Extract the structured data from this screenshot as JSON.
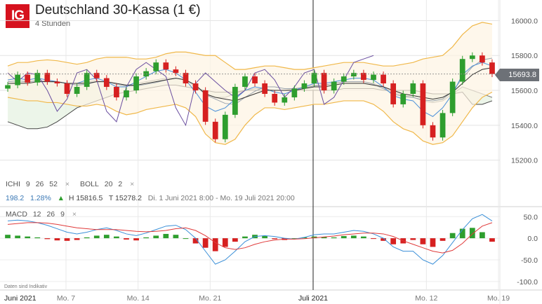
{
  "header": {
    "logo": "IG",
    "title": "Deutschland 30-Kassa (1 €)",
    "interval": "4 Stunden"
  },
  "indicators": {
    "ichi_name": "ICHI",
    "ichi_p1": "9",
    "ichi_p2": "26",
    "ichi_p3": "52",
    "boll_name": "BOLL",
    "boll_p1": "20",
    "boll_p2": "2",
    "remove_icon": "×"
  },
  "stats": {
    "value": "198.2",
    "change_pct": "1.28%",
    "high": "H 15816.5",
    "low": "T 15278.2",
    "range": "Di. 1 Juni 2021 8:00 - Mo. 19 Juli 2021 20:00"
  },
  "macd": {
    "name": "MACD",
    "p1": "12",
    "p2": "26",
    "p3": "9"
  },
  "last_price": "15693.8",
  "disclaimer": "Daten sind Indikativ",
  "colors": {
    "up": "#2e9e2e",
    "down": "#d62020",
    "band": "#f0b84a",
    "macd": "#3a8fd8",
    "signal": "#e03a3a"
  },
  "chart_data": [
    {
      "type": "line",
      "title": "Deutschland 30-Kassa (1 €)",
      "y_ticks": [
        "16000.0",
        "15800.0",
        "15600.0",
        "15400.0",
        "15200.0"
      ],
      "ylim": [
        15090,
        16070
      ],
      "last_price": 15693.8,
      "high": 15816.5,
      "low": 15278.2,
      "x_labels": [
        "Juni 2021",
        "Mo. 7",
        "Mo. 14",
        "Mo. 21",
        "Juli 2021",
        "Mo. 12",
        "Mo. 19"
      ],
      "x_days": [
        0,
        6,
        13,
        20,
        30,
        41,
        48
      ],
      "close": [
        15630,
        15690,
        15645,
        15700,
        15650,
        15640,
        15580,
        15620,
        15700,
        15670,
        15620,
        15560,
        15600,
        15680,
        15710,
        15760,
        15720,
        15700,
        15640,
        15600,
        15420,
        15320,
        15460,
        15620,
        15680,
        15640,
        15580,
        15530,
        15560,
        15610,
        15640,
        15700,
        15600,
        15650,
        15680,
        15700,
        15660,
        15690,
        15640,
        15520,
        15580,
        15640,
        15400,
        15330,
        15470,
        15650,
        15780,
        15800,
        15760,
        15694
      ],
      "bb_upper": [
        15740,
        15760,
        15760,
        15770,
        15775,
        15770,
        15760,
        15750,
        15760,
        15780,
        15790,
        15790,
        15790,
        15780,
        15780,
        15790,
        15810,
        15820,
        15820,
        15810,
        15800,
        15800,
        15760,
        15720,
        15720,
        15730,
        15740,
        15740,
        15730,
        15720,
        15720,
        15730,
        15740,
        15750,
        15760,
        15760,
        15760,
        15750,
        15740,
        15740,
        15750,
        15760,
        15780,
        15790,
        15800,
        15850,
        15920,
        15970,
        15990,
        15980
      ],
      "bb_lower": [
        15560,
        15550,
        15540,
        15540,
        15530,
        15530,
        15520,
        15510,
        15510,
        15520,
        15510,
        15480,
        15460,
        15470,
        15490,
        15500,
        15510,
        15520,
        15500,
        15450,
        15350,
        15300,
        15290,
        15320,
        15400,
        15460,
        15500,
        15500,
        15490,
        15500,
        15510,
        15520,
        15520,
        15530,
        15540,
        15540,
        15540,
        15520,
        15480,
        15420,
        15380,
        15360,
        15310,
        15290,
        15300,
        15340,
        15420,
        15500,
        15560,
        15590
      ],
      "bb_mid": [
        15650,
        15655,
        15650,
        15655,
        15652,
        15650,
        15640,
        15630,
        15635,
        15650,
        15650,
        15635,
        15625,
        15625,
        15635,
        15645,
        15660,
        15670,
        15660,
        15630,
        15575,
        15550,
        15525,
        15520,
        15560,
        15595,
        15620,
        15620,
        15610,
        15610,
        15615,
        15625,
        15630,
        15640,
        15650,
        15650,
        15650,
        15635,
        15610,
        15580,
        15565,
        15560,
        15545,
        15540,
        15550,
        15595,
        15670,
        15735,
        15775,
        15785
      ],
      "ichi_lines": {
        "tenkan": [
          15660,
          15670,
          15660,
          15670,
          15660,
          15650,
          15640,
          15640,
          15660,
          15670,
          15650,
          15620,
          15620,
          15650,
          15680,
          15710,
          15720,
          15700,
          15660,
          15590,
          15510,
          15480,
          15500,
          15550,
          15600,
          15620,
          15610,
          15590,
          15580,
          15600,
          15620,
          15640,
          15640,
          15650,
          15660,
          15670,
          15670,
          15660,
          15620,
          15570,
          15550,
          15540,
          15480,
          15450,
          15500,
          15580,
          15690,
          15740,
          15760,
          15740
        ],
        "kijun": [
          15640,
          15640,
          15640,
          15650,
          15650,
          15650,
          15640,
          15640,
          15640,
          15650,
          15650,
          15640,
          15630,
          15630,
          15640,
          15650,
          15660,
          15670,
          15660,
          15630,
          15580,
          15560,
          15550,
          15540,
          15560,
          15580,
          15600,
          15600,
          15600,
          15600,
          15610,
          15620,
          15620,
          15630,
          15640,
          15640,
          15640,
          15630,
          15620,
          15600,
          15580,
          15570,
          15560,
          15550,
          15560,
          15590,
          15640,
          15690,
          15720,
          15730
        ],
        "chikou": [
          15700,
          15650,
          15700,
          15690,
          15600,
          15480,
          15550,
          15700,
          15720,
          15660,
          15480,
          15420,
          15620,
          15720,
          15760,
          15720,
          15680,
          15500,
          15400,
          15640,
          15700,
          15650,
          15600,
          15560,
          15600,
          15700,
          15720,
          15660,
          15560,
          15620,
          15700,
          15720,
          15520,
          15560,
          15660,
          15760,
          15780,
          15800
        ]
      },
      "senkou_a": [
        15640,
        15645,
        15650,
        15655,
        15650,
        15645,
        15640,
        15640,
        15650,
        15655,
        15650,
        15640,
        15630,
        15640,
        15650,
        15660,
        15670,
        15670,
        15660,
        15620,
        15580,
        15560,
        15560,
        15580,
        15600,
        15610,
        15610,
        15600,
        15600,
        15610,
        15620,
        15630,
        15630,
        15640,
        15650,
        15650,
        15650,
        15640,
        15620,
        15590,
        15570,
        15560,
        15540,
        15530,
        15540,
        15580,
        15620,
        15600,
        15580,
        15560
      ],
      "senkou_b": [
        15420,
        15400,
        15380,
        15380,
        15390,
        15420,
        15460,
        15500,
        15520,
        15540,
        15560,
        15580,
        15590,
        15600,
        15610,
        15620,
        15630,
        15630,
        15620,
        15610,
        15600,
        15590,
        15590,
        15590,
        15600,
        15600,
        15600,
        15600,
        15600,
        15600,
        15600,
        15600,
        15600,
        15600,
        15610,
        15610,
        15610,
        15610,
        15600,
        15600,
        15600,
        15600,
        15590,
        15580,
        15580,
        15580,
        15590,
        15520,
        15520,
        15540
      ]
    },
    {
      "type": "bar",
      "title": "MACD 12 26 9",
      "y_ticks": [
        "50.0",
        "0.0",
        "-50.0",
        "-100.0"
      ],
      "ylim": [
        -110,
        65
      ],
      "histogram": [
        8,
        6,
        4,
        2,
        -2,
        -5,
        -6,
        -4,
        2,
        6,
        8,
        4,
        -3,
        -5,
        2,
        6,
        10,
        8,
        0,
        -12,
        -22,
        -30,
        -20,
        -8,
        4,
        8,
        5,
        -2,
        -4,
        0,
        2,
        4,
        3,
        2,
        5,
        6,
        4,
        -1,
        -6,
        -14,
        -12,
        -4,
        -14,
        -20,
        -6,
        12,
        22,
        24,
        14,
        -8
      ],
      "macd_line": [
        40,
        42,
        40,
        36,
        30,
        22,
        14,
        10,
        14,
        20,
        24,
        18,
        10,
        6,
        12,
        20,
        28,
        30,
        20,
        0,
        -30,
        -60,
        -50,
        -30,
        -8,
        4,
        6,
        4,
        0,
        -2,
        2,
        8,
        10,
        10,
        14,
        18,
        16,
        10,
        0,
        -20,
        -30,
        -30,
        -50,
        -60,
        -40,
        -10,
        20,
        45,
        55,
        40
      ],
      "signal_line": [
        32,
        34,
        36,
        36,
        35,
        32,
        28,
        24,
        22,
        20,
        20,
        20,
        18,
        16,
        15,
        16,
        18,
        22,
        24,
        18,
        6,
        -10,
        -22,
        -26,
        -22,
        -14,
        -8,
        -4,
        -2,
        -2,
        -1,
        1,
        3,
        5,
        8,
        10,
        12,
        12,
        10,
        4,
        -6,
        -14,
        -22,
        -30,
        -34,
        -28,
        -12,
        10,
        28,
        36
      ]
    }
  ]
}
